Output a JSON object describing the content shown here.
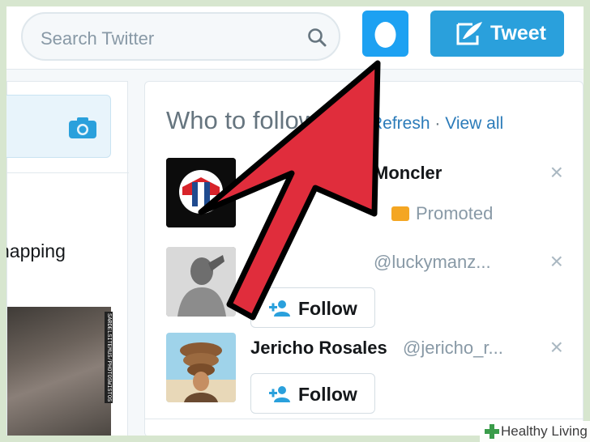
{
  "header": {
    "search_placeholder": "Search Twitter",
    "tweet_button_label": "Tweet"
  },
  "left": {
    "tweet_text": "napping",
    "photo_caption": "SARDELSITEMUS/PHOTOSWISTOS"
  },
  "who_to_follow": {
    "title": "Who to follow",
    "refresh_label": "Refresh",
    "view_all_label": "View all",
    "suggestions": [
      {
        "name": "Moncler",
        "handle": "",
        "promoted_label": "Promoted",
        "dismiss": "×"
      },
      {
        "name": "",
        "handle": "@luckymanz...",
        "follow_label": "Follow",
        "dismiss": "×"
      },
      {
        "name": "Jericho Rosales",
        "handle": "@jericho_r...",
        "follow_label": "Follow",
        "dismiss": "×"
      }
    ]
  },
  "watermark": "Healthy Living",
  "colors": {
    "twitter_blue": "#1da1f2",
    "tweet_button": "#2aa0dc",
    "link": "#2b7bb9",
    "arrow": "#e02d3c",
    "promoted": "#f4a623"
  },
  "icons": [
    "search-icon",
    "egg-avatar-icon",
    "quill-icon",
    "camera-icon",
    "add-user-icon",
    "close-icon",
    "promoted-icon"
  ]
}
